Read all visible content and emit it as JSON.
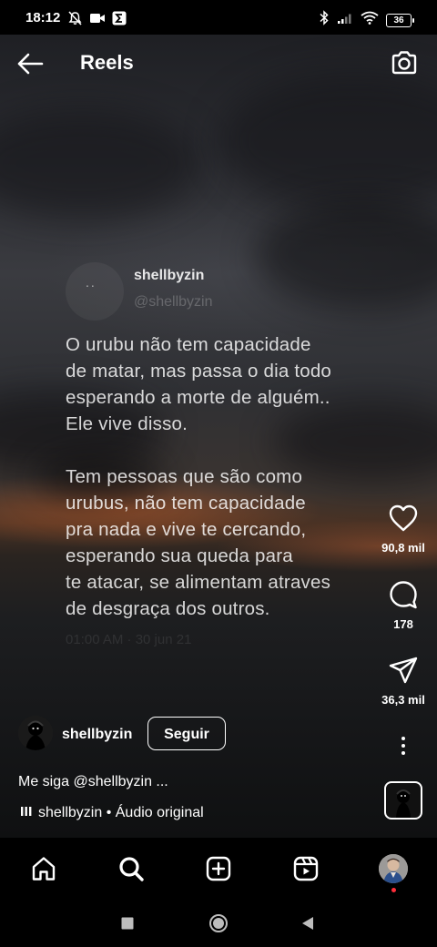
{
  "status_bar": {
    "time": "18:12",
    "battery": "36",
    "left_icons": [
      "notifications-off-icon",
      "video-camera-icon",
      "sigma-icon"
    ],
    "right_icons": [
      "bluetooth-icon",
      "signal-icon",
      "wifi-icon",
      "battery-icon"
    ]
  },
  "header": {
    "title": "Reels",
    "back_icon": "arrow-left-icon",
    "camera_icon": "camera-icon"
  },
  "post": {
    "username": "shellbyzin",
    "handle": "@shellbyzin",
    "text": "O urubu não tem capacidade\nde matar, mas passa o dia todo\nesperando a morte de alguém..\nEle vive disso.\n\nTem pessoas  que são como\nurubus, não tem capacidade\npra nada e vive te cercando,\nesperando sua queda para\nte atacar, se alimentam atraves\nde desgraça dos outros.",
    "date": "01:00 AM · 30 jun 21"
  },
  "actions": {
    "likes": "90,8 mil",
    "comments": "178",
    "shares": "36,3 mil"
  },
  "reel_info": {
    "username": "shellbyzin",
    "follow_label": "Seguir",
    "caption": "Me siga @shellbyzin ...",
    "audio": "shellbyzin • Áudio original"
  },
  "bottom_nav": [
    "home-icon",
    "search-icon",
    "create-icon",
    "reels-icon",
    "profile-avatar"
  ],
  "system_nav": [
    "recents-square",
    "home-circle",
    "back-triangle"
  ],
  "colors": {
    "background": "#000000",
    "text": "#ffffff",
    "notification_dot": "#ff2d3a"
  }
}
